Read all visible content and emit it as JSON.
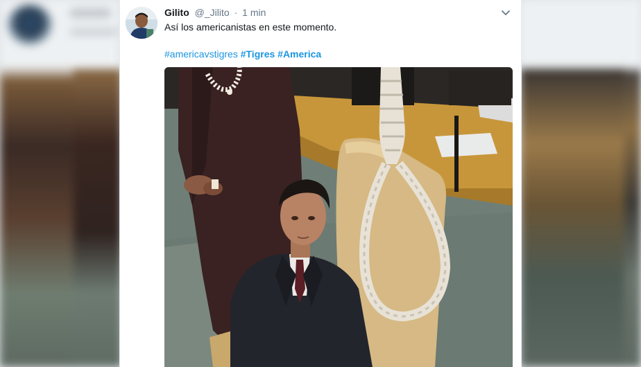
{
  "tweet": {
    "display_name": "Gilito",
    "handle": "@_Jilito",
    "separator": "·",
    "time": "1 min",
    "text": "Así los americanistas en este momento.",
    "hashtags": [
      "#americavstigres",
      "#Tigres",
      "#America"
    ]
  },
  "icons": {
    "more": "chevron-down-icon",
    "avatar": "avatar"
  },
  "colors": {
    "link": "#1b95e0",
    "muted": "#657786",
    "text": "#14171a"
  }
}
